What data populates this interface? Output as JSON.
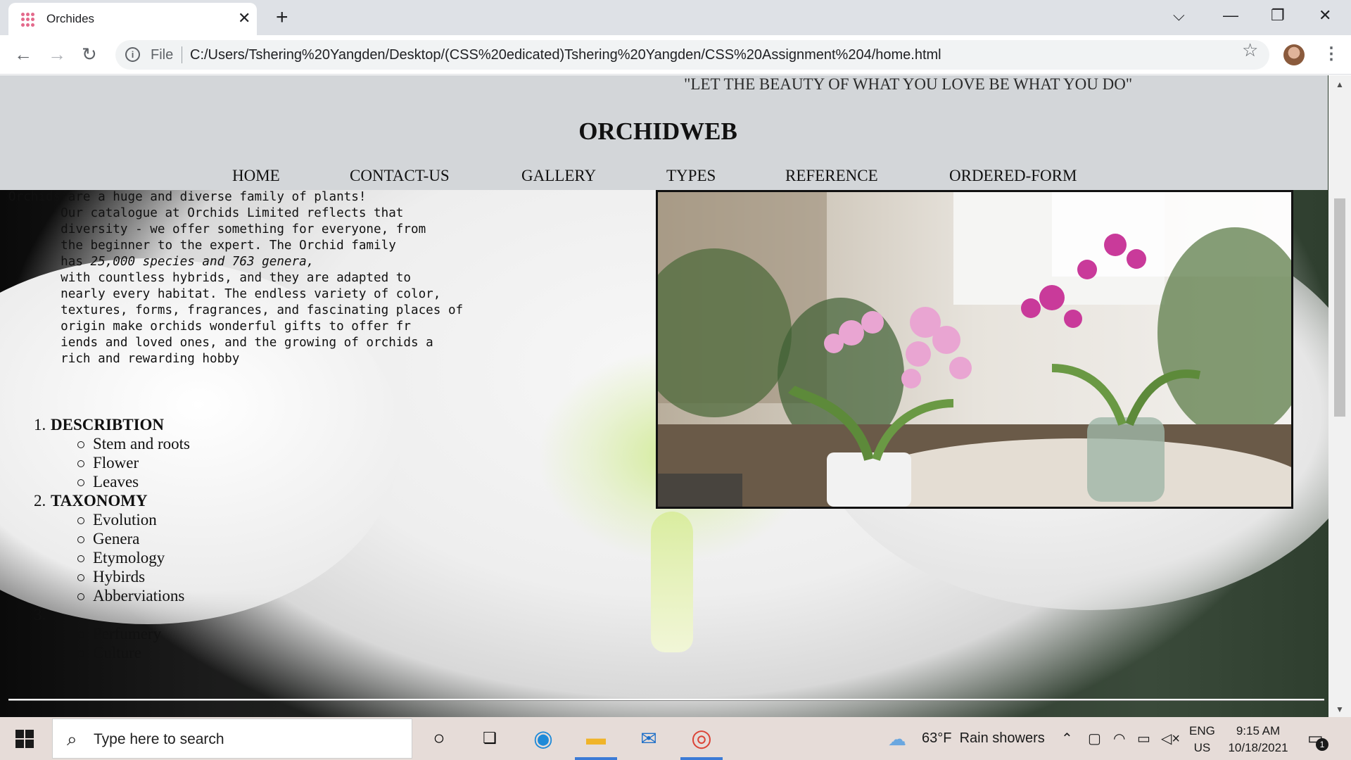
{
  "browser": {
    "tab": {
      "title": "Orchides",
      "close_glyph": "✕"
    },
    "new_tab_glyph": "+",
    "window_controls": {
      "dropdown": "⌵",
      "minimize": "—",
      "restore": "❐",
      "close": "✕"
    },
    "nav": {
      "back": "←",
      "forward": "→",
      "reload": "↻"
    },
    "omnibox": {
      "scheme_label": "File",
      "url": "C:/Users/Tshering%20Yangden/Desktop/(CSS%20edicated)Tshering%20Yangden/CSS%20Assignment%204/home.html"
    },
    "bookmark_glyph": "☆",
    "menu_glyph": "⋮"
  },
  "page": {
    "quote": "\"LET THE BEAUTY OF WHAT YOU LOVE BE WHAT YOU DO\"",
    "site_title": "ORCHIDWEB",
    "nav": [
      "HOME",
      "CONTACT-US",
      "GALLERY",
      "TYPES",
      "REFERENCE",
      "ORDERED-FORM"
    ],
    "intro": {
      "line1": "Orchids are a huge and diverse family of plants!",
      "line2": "       Our catalogue at Orchids Limited reflects that",
      "line3": "       diversity - we offer something for everyone, from",
      "line4": "       the beginner to the expert. The Orchid family",
      "line5_prefix": "       has ",
      "line5_em": "25,000 species and 763 genera,",
      "line6": "       with countless hybrids, and they are adapted to",
      "line7": "       nearly every habitat. The endless variety of color,",
      "line8": "       textures, forms, fragrances, and fascinating places of",
      "line9": "       origin make orchids wonderful gifts to offer fr",
      "line10": "       iends and loved ones, and the growing of orchids a",
      "line11": "       rich and rewarding hobby"
    },
    "outline": [
      {
        "num": "1.",
        "title": "DESCRIBTION",
        "items": [
          "Stem and roots",
          "Flower",
          "Leaves"
        ]
      },
      {
        "num": "2.",
        "title": "TAXONOMY",
        "items": [
          "Evolution",
          "Genera",
          "Etymology",
          "Hybirds",
          "Abberviations"
        ]
      },
      {
        "num": "3.",
        "title": "",
        "items": [
          "Perfumery",
          "Culture"
        ]
      }
    ]
  },
  "taskbar": {
    "search_placeholder": "Type here to search",
    "weather": {
      "temp": "63°F",
      "condition": "Rain showers"
    },
    "lang": {
      "code": "ENG",
      "region": "US"
    },
    "clock": {
      "time": "9:15 AM",
      "date": "10/18/2021"
    },
    "notification_count": "1"
  },
  "colors": {
    "header_bg": "#d3d6d9",
    "taskbar_bg": "#e6dcd8",
    "active_tab_underline": "#3c7bd6"
  }
}
